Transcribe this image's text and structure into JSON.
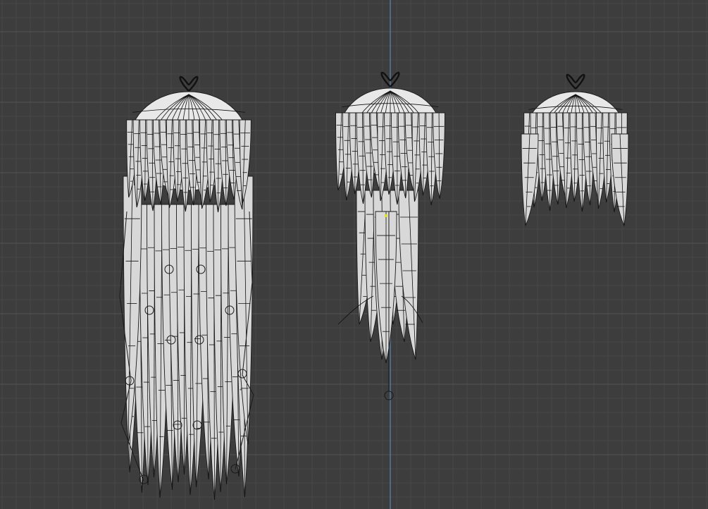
{
  "viewport": {
    "background_color": "#3d3d3d",
    "grid_minor_color": "#474747",
    "grid_major_color": "#525252",
    "axis_color": "#5a87b8",
    "origin_marker_color": "#e6e600"
  },
  "objects": [
    {
      "name": "long-hair-mesh",
      "mode": "wireframe"
    },
    {
      "name": "twin-tail-hair-mesh",
      "mode": "wireframe"
    },
    {
      "name": "short-hair-mesh",
      "mode": "wireframe"
    }
  ]
}
